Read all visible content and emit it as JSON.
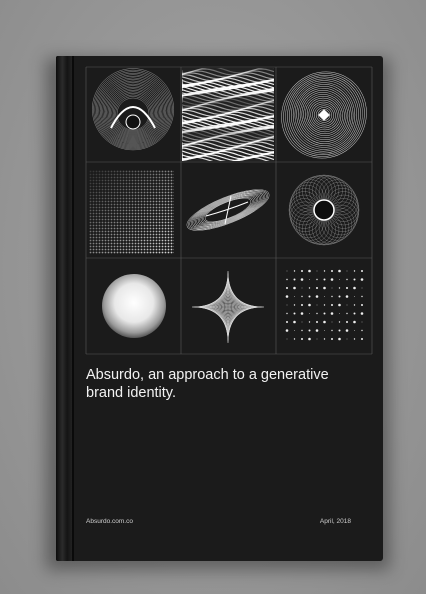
{
  "cover": {
    "title": "Absurdo, an approach to a generative brand identity.",
    "website": "Absurdo.com.co",
    "date": "April, 2018"
  },
  "colors": {
    "background": "#9a9a9a",
    "cover": "#1b1b1b",
    "text": "#f2f2f2",
    "grid_lines": "#5a5a5a"
  }
}
